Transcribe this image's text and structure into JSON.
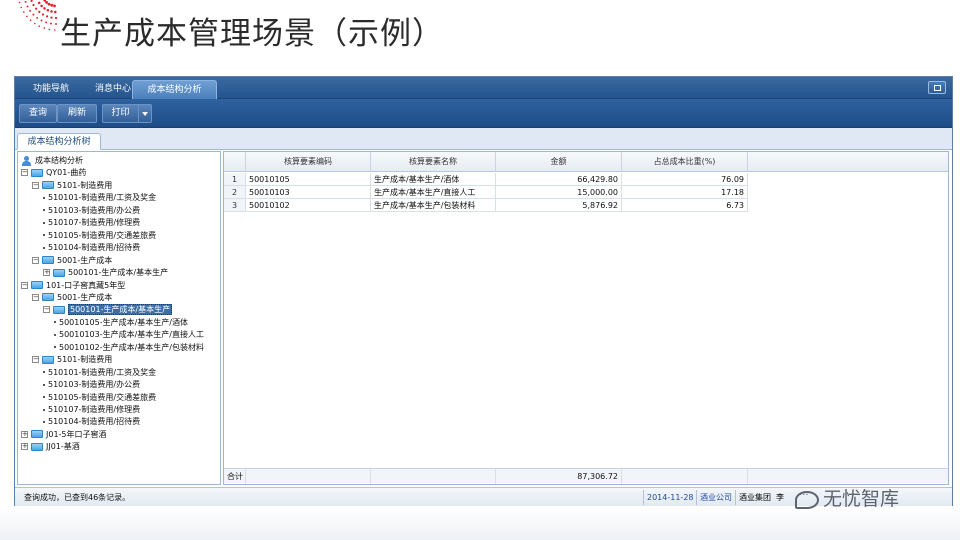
{
  "slide": {
    "title": "生产成本管理场景（示例）",
    "watermark": "无忧智库"
  },
  "app": {
    "tabs": [
      {
        "label": "功能导航",
        "active": false
      },
      {
        "label": "消息中心",
        "active": false
      },
      {
        "label": "成本结构分析",
        "active": true
      }
    ],
    "toolbar": {
      "query_label": "查询",
      "refresh_label": "刷新",
      "print_label": "打印"
    },
    "subtab": "成本结构分析树",
    "tree": [
      {
        "label": "成本结构分析",
        "level": 0,
        "kind": "root"
      },
      {
        "label": "QY01-曲药",
        "level": 0,
        "kind": "folder",
        "exp": "−"
      },
      {
        "label": "5101-制造费用",
        "level": 1,
        "kind": "folder",
        "exp": "−"
      },
      {
        "label": "510101-制造费用/工资及奖金",
        "level": 2,
        "kind": "leaf"
      },
      {
        "label": "510103-制造费用/办公费",
        "level": 2,
        "kind": "leaf"
      },
      {
        "label": "510107-制造费用/修理费",
        "level": 2,
        "kind": "leaf"
      },
      {
        "label": "510105-制造费用/交通差旅费",
        "level": 2,
        "kind": "leaf"
      },
      {
        "label": "510104-制造费用/招待费",
        "level": 2,
        "kind": "leaf"
      },
      {
        "label": "5001-生产成本",
        "level": 1,
        "kind": "folder",
        "exp": "−"
      },
      {
        "label": "500101-生产成本/基本生产",
        "level": 2,
        "kind": "folder",
        "exp": "+"
      },
      {
        "label": "101-口子窖真藏5年型",
        "level": 0,
        "kind": "folder",
        "exp": "−"
      },
      {
        "label": "5001-生产成本",
        "level": 1,
        "kind": "folder",
        "exp": "−"
      },
      {
        "label": "500101-生产成本/基本生产",
        "level": 2,
        "kind": "folder",
        "exp": "−",
        "selected": true
      },
      {
        "label": "50010105-生产成本/基本生产/酒体",
        "level": 3,
        "kind": "leaf"
      },
      {
        "label": "50010103-生产成本/基本生产/直接人工",
        "level": 3,
        "kind": "leaf"
      },
      {
        "label": "50010102-生产成本/基本生产/包装材料",
        "level": 3,
        "kind": "leaf"
      },
      {
        "label": "5101-制造费用",
        "level": 1,
        "kind": "folder",
        "exp": "−"
      },
      {
        "label": "510101-制造费用/工资及奖金",
        "level": 2,
        "kind": "leaf"
      },
      {
        "label": "510103-制造费用/办公费",
        "level": 2,
        "kind": "leaf"
      },
      {
        "label": "510105-制造费用/交通差旅费",
        "level": 2,
        "kind": "leaf"
      },
      {
        "label": "510107-制造费用/修理费",
        "level": 2,
        "kind": "leaf"
      },
      {
        "label": "510104-制造费用/招待费",
        "level": 2,
        "kind": "leaf"
      },
      {
        "label": "J01-5年口子窖酒",
        "level": 0,
        "kind": "folder",
        "exp": "+"
      },
      {
        "label": "JJ01-基酒",
        "level": 0,
        "kind": "folder",
        "exp": "+"
      }
    ],
    "grid": {
      "columns": [
        "核算要素编码",
        "核算要素名称",
        "金额",
        "占总成本比重(%)"
      ],
      "rows": [
        {
          "n": "1",
          "code": "50010105",
          "name": "生产成本/基本生产/酒体",
          "amount": "66,429.80",
          "pct": "76.09"
        },
        {
          "n": "2",
          "code": "50010103",
          "name": "生产成本/基本生产/直接人工",
          "amount": "15,000.00",
          "pct": "17.18"
        },
        {
          "n": "3",
          "code": "50010102",
          "name": "生产成本/基本生产/包装材料",
          "amount": "5,876.92",
          "pct": "6.73"
        }
      ],
      "total_label": "合计",
      "total_amount": "87,306.72"
    },
    "status": {
      "message": "查询成功，已查到46条记录。",
      "date": "2014-11-28",
      "company": "酒业公司",
      "group": "酒业集团",
      "user": "李"
    },
    "colors": {
      "header_blue": "#24558e",
      "selected_blue": "#3a6ea5",
      "date_blue": "#1e4a9c"
    }
  }
}
